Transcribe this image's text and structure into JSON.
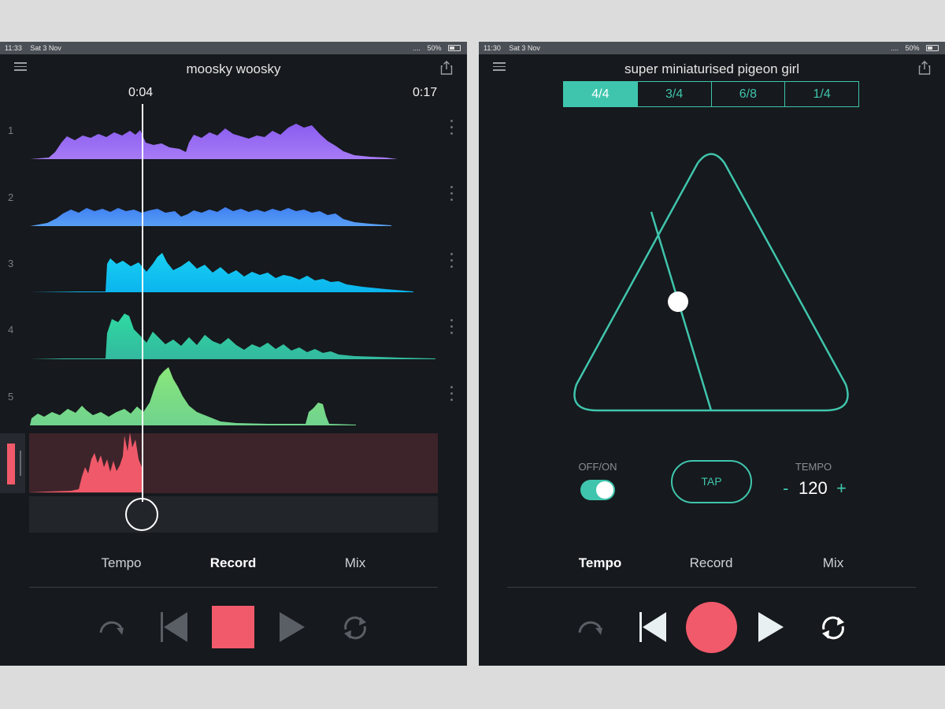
{
  "left": {
    "status": {
      "time": "11:33",
      "date": "Sat 3 Nov",
      "signal": "....",
      "battery": "50%"
    },
    "title": "moosky woosky",
    "current_time": "0:04",
    "end_time": "0:17",
    "tracks": [
      {
        "number": "1",
        "color": "#8a5cf0",
        "color2": "#a67bf5"
      },
      {
        "number": "2",
        "color": "#3f7ff2",
        "color2": "#58a0f5"
      },
      {
        "number": "3",
        "color": "#19d0f2",
        "color2": "#0bb4ee"
      },
      {
        "number": "4",
        "color": "#2fd9a2",
        "color2": "#33b99f"
      },
      {
        "number": "5",
        "color": "#8ae67a",
        "color2": "#6fd38d"
      }
    ],
    "recording_color": "#f15a6a",
    "tabs": [
      "Tempo",
      "Record",
      "Mix"
    ],
    "active_tab": "Record"
  },
  "right": {
    "status": {
      "time": "11:30",
      "date": "Sat 3 Nov",
      "signal": "....",
      "battery": "50%"
    },
    "title": "super miniaturised pigeon girl",
    "time_signatures": [
      "4/4",
      "3/4",
      "6/8",
      "1/4"
    ],
    "selected_signature": "4/4",
    "toggle_label": "OFF/ON",
    "toggle_on": true,
    "tap_label": "TAP",
    "tempo_label": "TEMPO",
    "tempo_minus": "-",
    "tempo_value": "120",
    "tempo_plus": "+",
    "tabs": [
      "Tempo",
      "Record",
      "Mix"
    ],
    "active_tab": "Tempo"
  },
  "colors": {
    "accent": "#3fc5ad",
    "record": "#f15a6a",
    "background": "#16191d"
  },
  "icons": {
    "menu": "hamburger-icon",
    "share": "share-icon",
    "undo": "undo-icon",
    "skip_back": "skip-back-icon",
    "stop": "stop-icon",
    "record": "record-icon",
    "play": "play-icon",
    "loop": "loop-icon"
  }
}
